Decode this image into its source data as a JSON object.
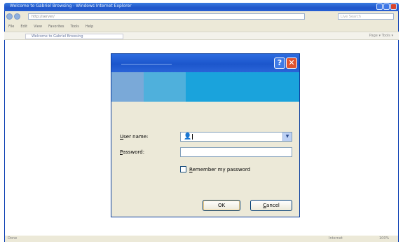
{
  "browser": {
    "title": "Welcome to Gabriel Browsing - Windows Internet Explorer",
    "address": "http://server/",
    "search_placeholder": "Live Search",
    "menu": [
      "File",
      "Edit",
      "View",
      "Favorites",
      "Tools",
      "Help"
    ],
    "tab_label": "Welcome to Gabriel Browsing",
    "toolbar_right": "Page  ▾  Tools  ▾",
    "status_left": "Done",
    "status_zone": "Internet",
    "status_zoom": "100%"
  },
  "dialog": {
    "help_glyph": "?",
    "close_glyph": "✕",
    "username_label_prefix": "U",
    "username_label_rest": "ser name:",
    "password_label_prefix": "P",
    "password_label_rest": "assword:",
    "username_value": "",
    "password_value": "",
    "remember_label_prefix": "R",
    "remember_label_rest": "emember my password",
    "remember_checked": false,
    "ok_label": "OK",
    "cancel_label": "Cancel"
  },
  "colors": {
    "title_blue": "#1f55c9",
    "banner_blue": "#1aa3dc",
    "dialog_bg": "#ece9d8"
  }
}
